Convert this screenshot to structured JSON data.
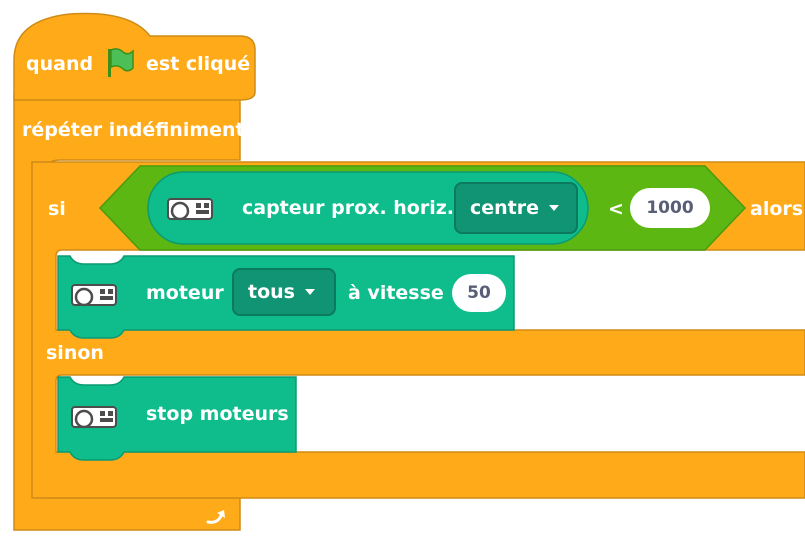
{
  "colors": {
    "event": "#FFAB19",
    "control": "#FFAB19",
    "sensor_bool": "#5CB712",
    "motor": "#0FBD8C",
    "text": "#FFFFFF",
    "number_text": "#575E75"
  },
  "event_block": {
    "prefix": "quand",
    "icon": "green-flag-icon",
    "suffix": "est cliqué"
  },
  "forever_block": {
    "label": "répéter indéfiniment",
    "loop_icon": "loop-arrow-icon"
  },
  "if_block": {
    "if_label": "si",
    "then_label": "alors",
    "else_label": "sinon",
    "condition": {
      "operator": "<",
      "sensor_reporter": {
        "icon": "robot-icon",
        "label": "capteur prox. horiz.",
        "dropdown_value": "centre"
      },
      "compare_value": "1000"
    }
  },
  "then_branch": {
    "icon": "robot-icon",
    "label": "moteur",
    "dropdown_value": "tous",
    "speed_label": "à vitesse",
    "speed_value": "50"
  },
  "else_branch": {
    "icon": "robot-icon",
    "label": "stop moteurs"
  }
}
